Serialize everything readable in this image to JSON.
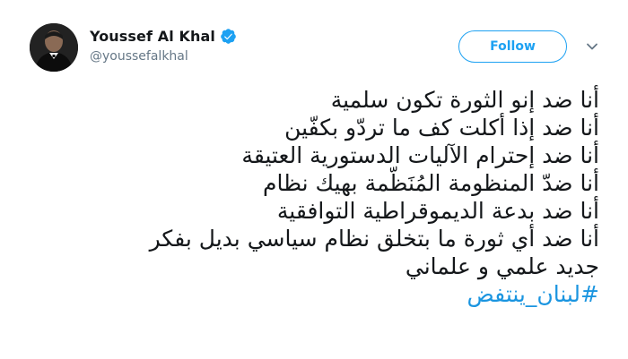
{
  "author": {
    "name": "Youssef Al Khal",
    "handle": "@youssefalkhal",
    "verified": true,
    "avatar_icon": "profile-photo"
  },
  "actions": {
    "follow_label": "Follow",
    "menu_icon": "chevron-down-icon"
  },
  "tweet": {
    "lines": [
      "أنا ضد إنو الثورة تكون سلمية",
      "أنا ضد إذا أكلت كف ما تردّو بكفّين",
      "أنا ضد إحترام الآليات الدستورية العتيقة",
      "أنا ضدّ المنظومة المُنَظّمة بهيك نظام",
      "أنا ضد بدعة الديموقراطية التوافقية",
      "أنا ضد أي ثورة ما بتخلق نظام سياسي بديل بفكر",
      "جديد علمي و علماني"
    ],
    "hashtag": "#لبنان_ينتفض"
  },
  "colors": {
    "accent": "#1da1f2",
    "hashtag": "#1b95e0",
    "text": "#14171a",
    "secondary": "#657786"
  }
}
